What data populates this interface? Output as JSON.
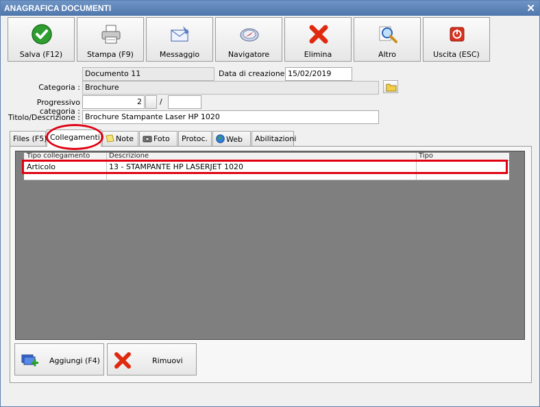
{
  "window": {
    "title": "ANAGRAFICA DOCUMENTI",
    "close": "✕"
  },
  "toolbar": {
    "buttons": [
      {
        "label": "Salva (F12)",
        "icon": "checkmark-icon"
      },
      {
        "label": "Stampa (F9)",
        "icon": "printer-icon"
      },
      {
        "label": "Messaggio",
        "icon": "envelope-icon"
      },
      {
        "label": "Navigatore",
        "icon": "compass-icon"
      },
      {
        "label": "Elimina",
        "icon": "delete-x-icon"
      },
      {
        "label": "Altro",
        "icon": "magnifier-icon"
      },
      {
        "label": "Uscita (ESC)",
        "icon": "power-icon"
      }
    ]
  },
  "form": {
    "document": "Documento 11",
    "creation_label": "Data di creazione :",
    "creation_date": "15/02/2019",
    "category_label": "Categoria :",
    "category": "Brochure",
    "progressive_label": "Progressivo categoria :",
    "progressive_value": "2",
    "separator": "/",
    "progressive_suffix": "",
    "title_label": "Titolo/Descrizione :",
    "title_value": "Brochure Stampante Laser HP 1020"
  },
  "tabs": [
    {
      "label": "Files (F5)"
    },
    {
      "label": "Collegamenti"
    },
    {
      "label": "Note"
    },
    {
      "label": "Foto"
    },
    {
      "label": "Protoc."
    },
    {
      "label": "Web"
    },
    {
      "label": "Abilitazioni"
    }
  ],
  "grid": {
    "columns": [
      "Tipo collegamento",
      "Descrizione",
      "Tipo"
    ],
    "rows": [
      [
        "Articolo",
        "13 - STAMPANTE HP LASERJET 1020",
        ""
      ],
      [
        "",
        "",
        ""
      ]
    ]
  },
  "bottom": {
    "add_label": "Aggiungi (F4)",
    "remove_label": "Rimuovi"
  },
  "colors": {
    "accent": "#e00010",
    "titlebar": "#5b82b6"
  }
}
